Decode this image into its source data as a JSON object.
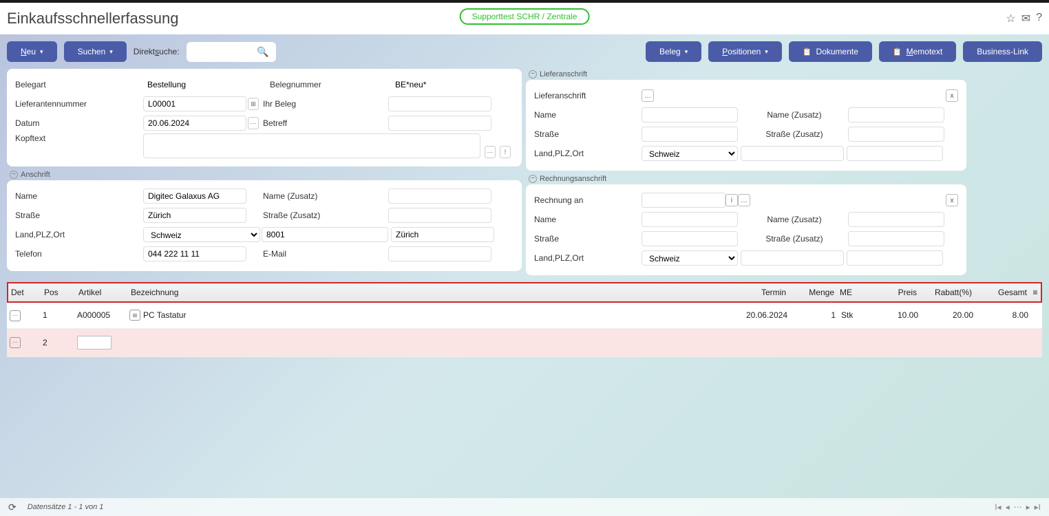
{
  "header": {
    "title": "Einkaufsschnellerfassung",
    "support_badge": "Supporttest SCHR / Zentrale"
  },
  "toolbar": {
    "neu": "Neu",
    "suchen": "Suchen",
    "direktsuche_label": "Direktsuche:",
    "beleg": "Beleg",
    "positionen": "Positionen",
    "dokumente": "Dokumente",
    "memotext": "Memotext",
    "business_link": "Business-Link"
  },
  "doc": {
    "belegart_label": "Belegart",
    "belegart_value": "Bestellung",
    "belegnummer_label": "Belegnummer",
    "belegnummer_value": "BE*neu*",
    "lieferantennummer_label": "Lieferantennummer",
    "lieferantennummer_value": "L00001",
    "ihr_beleg_label": "Ihr Beleg",
    "datum_label": "Datum",
    "datum_value": "20.06.2024",
    "betreff_label": "Betreff",
    "kopftext_label": "Kopftext"
  },
  "liefer": {
    "section": "Lieferanschrift",
    "lieferanschrift_label": "Lieferanschrift",
    "x": "x",
    "name_label": "Name",
    "name_zusatz_label": "Name (Zusatz)",
    "strasse_label": "Straße",
    "strasse_zusatz_label": "Straße (Zusatz)",
    "land_label": "Land,PLZ,Ort",
    "land_value": "Schweiz"
  },
  "anschrift": {
    "section": "Anschrift",
    "name_label": "Name",
    "name_value": "Digitec Galaxus AG",
    "name_zusatz_label": "Name (Zusatz)",
    "strasse_label": "Straße",
    "strasse_value": "Zürich",
    "strasse_zusatz_label": "Straße (Zusatz)",
    "land_label": "Land,PLZ,Ort",
    "land_value": "Schweiz",
    "plz_value": "8001",
    "ort_value": "Zürich",
    "telefon_label": "Telefon",
    "telefon_value": "044 222 11 11",
    "email_label": "E-Mail"
  },
  "rechnung": {
    "section": "Rechnungsanschrift",
    "rechnung_an_label": "Rechnung an",
    "x": "x",
    "name_label": "Name",
    "name_zusatz_label": "Name (Zusatz)",
    "strasse_label": "Straße",
    "strasse_zusatz_label": "Straße (Zusatz)",
    "land_label": "Land,PLZ,Ort",
    "land_value": "Schweiz"
  },
  "grid": {
    "headers": {
      "det": "Det",
      "pos": "Pos",
      "artikel": "Artikel",
      "bezeichnung": "Bezeichnung",
      "termin": "Termin",
      "menge": "Menge",
      "me": "ME",
      "preis": "Preis",
      "rabatt": "Rabatt(%)",
      "gesamt": "Gesamt"
    },
    "rows": [
      {
        "pos": "1",
        "artikel": "A000005",
        "bezeichnung": "PC Tastatur",
        "termin": "20.06.2024",
        "menge": "1",
        "me": "Stk",
        "preis": "10.00",
        "rabatt": "20.00",
        "gesamt": "8.00"
      },
      {
        "pos": "2"
      }
    ]
  },
  "footer": {
    "records": "Datensätze 1 - 1 von 1"
  },
  "misc": {
    "ellipsis": "…",
    "dots": "⋯",
    "info_i": "!",
    "menu": "≡"
  }
}
